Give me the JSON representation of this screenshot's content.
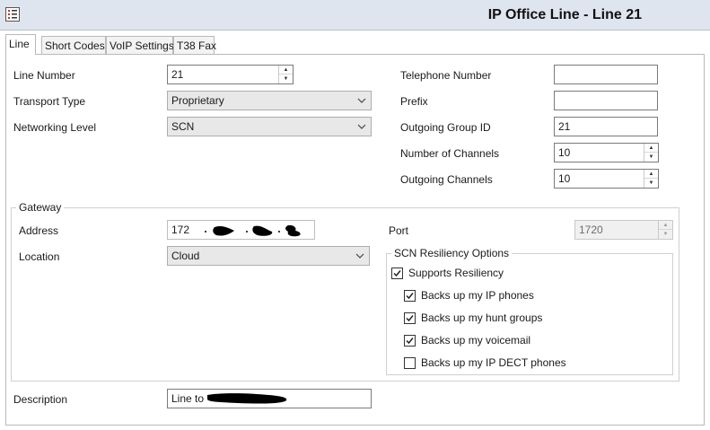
{
  "window": {
    "title": "IP Office Line - Line 21"
  },
  "tabs": [
    {
      "label": "Line"
    },
    {
      "label": "Short Codes"
    },
    {
      "label": "VoIP Settings"
    },
    {
      "label": "T38 Fax"
    }
  ],
  "line": {
    "line_number": {
      "label": "Line Number",
      "value": "21"
    },
    "transport_type": {
      "label": "Transport Type",
      "value": "Proprietary"
    },
    "networking_level": {
      "label": "Networking Level",
      "value": "SCN"
    },
    "telephone_number": {
      "label": "Telephone Number",
      "value": ""
    },
    "prefix": {
      "label": "Prefix",
      "value": ""
    },
    "outgoing_group_id": {
      "label": "Outgoing Group ID",
      "value": "21"
    },
    "number_of_channels": {
      "label": "Number of Channels",
      "value": "10"
    },
    "outgoing_channels": {
      "label": "Outgoing Channels",
      "value": "10"
    }
  },
  "gateway": {
    "title": "Gateway",
    "address": {
      "label": "Address",
      "value": "172"
    },
    "location": {
      "label": "Location",
      "value": "Cloud"
    },
    "port": {
      "label": "Port",
      "value": "1720"
    }
  },
  "resiliency": {
    "title": "SCN Resiliency Options",
    "options": [
      {
        "label": "Supports Resiliency",
        "checked": true
      },
      {
        "label": "Backs up my IP phones",
        "checked": true
      },
      {
        "label": "Backs up my hunt groups",
        "checked": true
      },
      {
        "label": "Backs up my voicemail",
        "checked": true
      },
      {
        "label": "Backs up my IP DECT phones",
        "checked": false
      }
    ]
  },
  "description": {
    "label": "Description",
    "value": "Line to"
  }
}
